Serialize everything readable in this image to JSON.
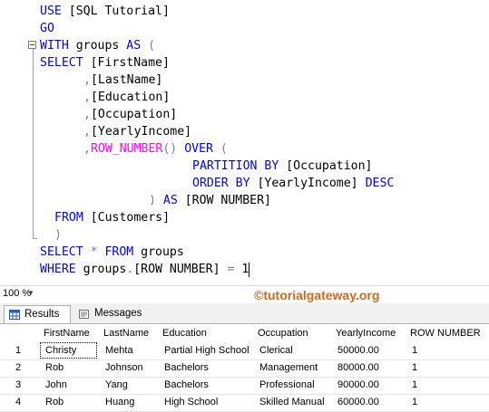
{
  "editor": {
    "line1": {
      "kw": "USE",
      "rest": " [SQL Tutorial]"
    },
    "line2": {
      "kw": "GO"
    },
    "line3": {
      "kw1": "WITH",
      "name": " groups ",
      "kw2": "AS",
      "paren": " ("
    },
    "line4": {
      "kw": "SELECT",
      "col": " [FirstName]"
    },
    "line5": {
      "comma": ",",
      "col": "[LastName]"
    },
    "line6": {
      "comma": ",",
      "col": "[Education]"
    },
    "line7": {
      "comma": ",",
      "col": "[Occupation]"
    },
    "line8": {
      "comma": ",",
      "col": "[YearlyIncome]"
    },
    "line9": {
      "comma": ",",
      "fn": "ROW_NUMBER",
      "paren": "()",
      "kw": " OVER",
      "open": " ("
    },
    "line10": {
      "kw": "PARTITION BY",
      "col": " [Occupation]"
    },
    "line11": {
      "kw": "ORDER BY",
      "col": " [YearlyIncome]",
      "kw2": " DESC"
    },
    "line12": {
      "paren": ")",
      "kw": " AS",
      "col": " [ROW NUMBER]"
    },
    "line13": {
      "kw": "FROM",
      "col": " [Customers]"
    },
    "line14": {
      "paren": ")"
    },
    "line15": {
      "kw1": "SELECT",
      "star": " *",
      "kw2": " FROM",
      "rest": " groups"
    },
    "line16": {
      "kw": "WHERE",
      "rest": " groups",
      "dot": ".",
      "col": "[ROW NUMBER]",
      "eq": " =",
      "num": " 1"
    }
  },
  "zoom": {
    "value": "100 %"
  },
  "watermark": "©tutorialgateway.org",
  "tabs": [
    {
      "label": "Results"
    },
    {
      "label": "Messages"
    }
  ],
  "grid": {
    "columns": [
      "FirstName",
      "LastName",
      "Education",
      "Occupation",
      "YearlyIncome",
      "ROW NUMBER"
    ],
    "rows": [
      {
        "num": "1",
        "cells": [
          "Christy",
          "Mehta",
          "Partial High School",
          "Clerical",
          "50000.00",
          "1"
        ]
      },
      {
        "num": "2",
        "cells": [
          "Rob",
          "Johnson",
          "Bachelors",
          "Management",
          "80000.00",
          "1"
        ]
      },
      {
        "num": "3",
        "cells": [
          "John",
          "Yang",
          "Bachelors",
          "Professional",
          "90000.00",
          "1"
        ]
      },
      {
        "num": "4",
        "cells": [
          "Rob",
          "Huang",
          "High School",
          "Skilled Manual",
          "60000.00",
          "1"
        ]
      }
    ]
  },
  "colors": {
    "keyword": "#0000ff",
    "function": "#ff00ff",
    "operator": "#808080",
    "watermark": "#d2691e"
  }
}
